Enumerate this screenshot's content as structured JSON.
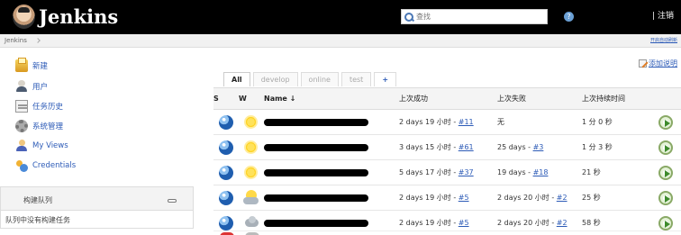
{
  "header": {
    "logo_text": "Jenkins",
    "search_placeholder": "查找",
    "help_icon": "?",
    "logout_label": "| 注销"
  },
  "breadcrumb": {
    "items": [
      "Jenkins"
    ],
    "auto_refresh": "开启自动刷新"
  },
  "sidebar": {
    "items": [
      {
        "label": "新建",
        "icon": "new-job-icon"
      },
      {
        "label": "用户",
        "icon": "users-icon"
      },
      {
        "label": "任务历史",
        "icon": "history-icon"
      },
      {
        "label": "系统管理",
        "icon": "settings-icon"
      },
      {
        "label": "My Views",
        "icon": "my-views-icon"
      },
      {
        "label": "Credentials",
        "icon": "credentials-icon"
      }
    ],
    "queue": {
      "title": "构建队列",
      "empty": "队列中没有构建任务"
    }
  },
  "main": {
    "add_description": "添加说明",
    "tabs": [
      {
        "label": "All",
        "active": true
      },
      {
        "label": "develop",
        "active": false
      },
      {
        "label": "online",
        "active": false
      },
      {
        "label": "test",
        "active": false
      },
      {
        "label": "+",
        "active": false
      }
    ],
    "table": {
      "headers": [
        "S",
        "W",
        "Name ↓",
        "上次成功",
        "上次失败",
        "上次持续时间",
        ""
      ],
      "rows": [
        {
          "status": "blue",
          "weather": "sunny",
          "last_success": "2 days 19 小时 - ",
          "last_success_link": "#11",
          "last_failure": "无",
          "last_failure_link": "",
          "duration": "1 分 0 秒"
        },
        {
          "status": "blue",
          "weather": "sunny",
          "last_success": "3 days 15 小时 - ",
          "last_success_link": "#61",
          "last_failure": "25 days - ",
          "last_failure_link": "#3",
          "duration": "1 分 3 秒"
        },
        {
          "status": "blue",
          "weather": "sunny",
          "last_success": "5 days 17 小时 - ",
          "last_success_link": "#37",
          "last_failure": "19 days - ",
          "last_failure_link": "#18",
          "duration": "21 秒"
        },
        {
          "status": "blue",
          "weather": "partly-cloudy",
          "last_success": "2 days 19 小时 - ",
          "last_success_link": "#5",
          "last_failure": "2 days 20 小时 - ",
          "last_failure_link": "#2",
          "duration": "25 秒"
        },
        {
          "status": "blue",
          "weather": "cloudy",
          "last_success": "2 days 19 小时 - ",
          "last_success_link": "#5",
          "last_failure": "2 days 20 小时 - ",
          "last_failure_link": "#2",
          "duration": "58 秒"
        }
      ]
    }
  },
  "colors": {
    "header_bg": "#000000",
    "link_blue": "#2d5bb7",
    "status_blue": "#1f5eaf",
    "schedule_green": "#3e8b2c"
  }
}
